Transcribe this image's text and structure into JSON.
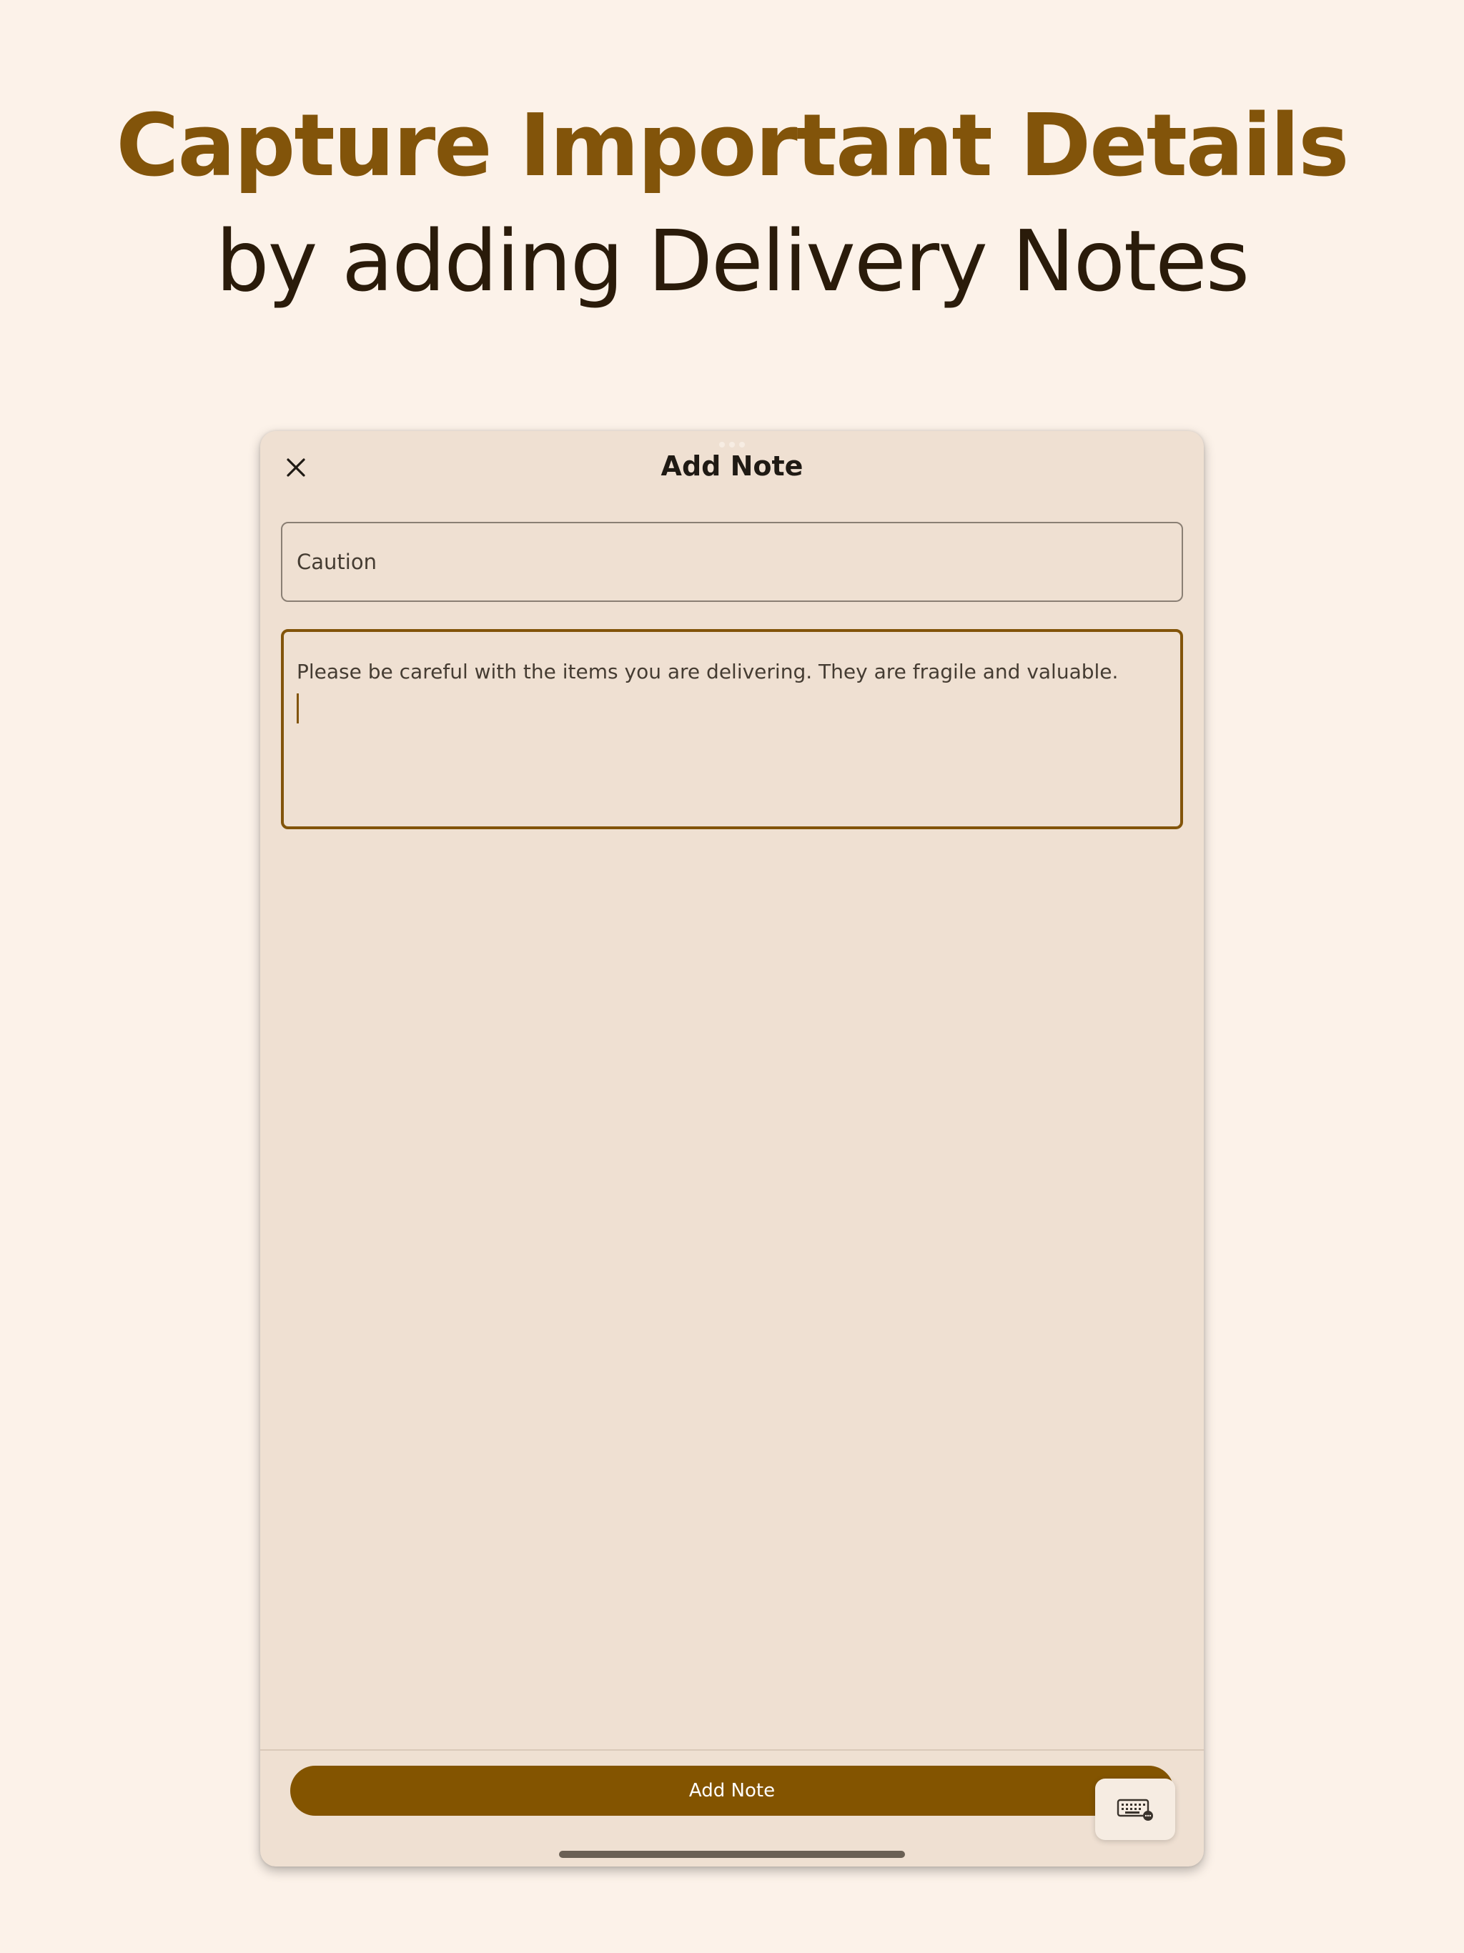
{
  "hero": {
    "headline": "Capture Important Details",
    "subheadline": "by adding Delivery Notes"
  },
  "sheet": {
    "title": "Add Note",
    "close_icon": "close-icon",
    "title_field": {
      "value": "Caution"
    },
    "note_field": {
      "value": "Please be careful with the items you are delivering. They are fragile and valuable."
    },
    "primary_button_label": "Add Note",
    "keyboard_icon": "keyboard-icon"
  },
  "colors": {
    "accent": "#835400",
    "background": "#fcf2e9",
    "sheet_background": "#efe0d2",
    "text_dark": "#2a1b0a"
  }
}
